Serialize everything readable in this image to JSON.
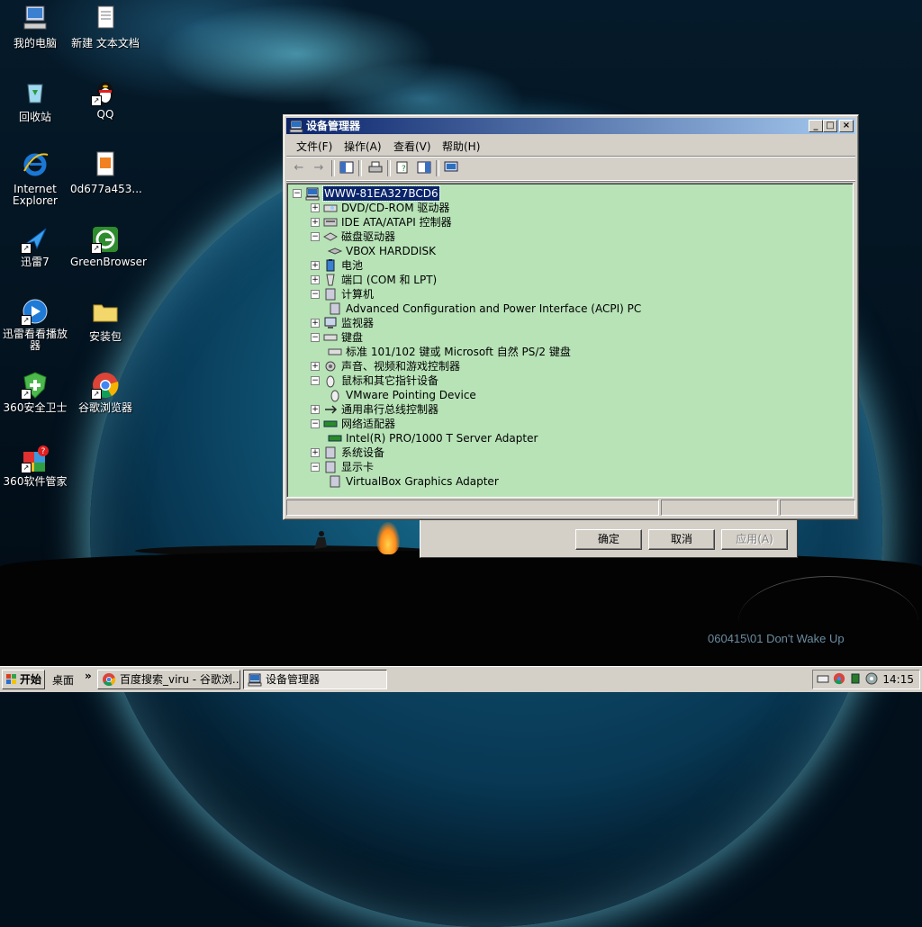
{
  "desktop": {
    "icons": [
      {
        "label": "我的电脑",
        "icon": "my-computer-icon"
      },
      {
        "label": "新建 文本文档",
        "icon": "text-document-icon"
      },
      {
        "label": "回收站",
        "icon": "recycle-bin-icon"
      },
      {
        "label": "QQ",
        "icon": "qq-penguin-icon"
      },
      {
        "label": "Internet Explorer",
        "icon": "internet-explorer-icon"
      },
      {
        "label": "0d677a453...",
        "icon": "image-file-icon"
      },
      {
        "label": "迅雷7",
        "icon": "thunder-icon"
      },
      {
        "label": "GreenBrowser",
        "icon": "greenbrowser-icon"
      },
      {
        "label": "迅雷看看播放器",
        "icon": "xunlei-player-icon"
      },
      {
        "label": "安装包",
        "icon": "folder-icon"
      },
      {
        "label": "360安全卫士",
        "icon": "360-shield-icon"
      },
      {
        "label": "谷歌浏览器",
        "icon": "chrome-icon"
      },
      {
        "label": "360软件管家",
        "icon": "360-software-icon"
      }
    ],
    "wallpaper_caption": "060415\\01 Don't Wake Up"
  },
  "bg_dialog": {
    "ok_label": "确定",
    "cancel_label": "取消",
    "apply_label": "应用(A)"
  },
  "window": {
    "title": "设备管理器",
    "menu": [
      "文件(F)",
      "操作(A)",
      "查看(V)",
      "帮助(H)"
    ],
    "tree": {
      "root": "WWW-81EA327BCD6",
      "items": [
        {
          "label": "DVD/CD-ROM 驱动器",
          "level": 1,
          "expander": "+",
          "icon": "cdrom-drive-icon"
        },
        {
          "label": "IDE ATA/ATAPI 控制器",
          "level": 1,
          "expander": "+",
          "icon": "ide-controller-icon"
        },
        {
          "label": "磁盘驱动器",
          "level": 1,
          "expander": "-",
          "icon": "disk-drive-icon"
        },
        {
          "label": "VBOX HARDDISK",
          "level": 2,
          "expander": "",
          "icon": "hard-disk-icon"
        },
        {
          "label": "电池",
          "level": 1,
          "expander": "+",
          "icon": "battery-icon"
        },
        {
          "label": "端口 (COM 和 LPT)",
          "level": 1,
          "expander": "+",
          "icon": "port-icon"
        },
        {
          "label": "计算机",
          "level": 1,
          "expander": "-",
          "icon": "computer-icon"
        },
        {
          "label": "Advanced Configuration and Power Interface (ACPI) PC",
          "level": 2,
          "expander": "",
          "icon": "acpi-pc-icon"
        },
        {
          "label": "监视器",
          "level": 1,
          "expander": "+",
          "icon": "monitor-icon"
        },
        {
          "label": "键盘",
          "level": 1,
          "expander": "-",
          "icon": "keyboard-icon"
        },
        {
          "label": "标准 101/102 键或 Microsoft 自然 PS/2 键盘",
          "level": 2,
          "expander": "",
          "icon": "keyboard-device-icon"
        },
        {
          "label": "声音、视频和游戏控制器",
          "level": 1,
          "expander": "+",
          "icon": "sound-icon"
        },
        {
          "label": "鼠标和其它指针设备",
          "level": 1,
          "expander": "-",
          "icon": "mouse-icon"
        },
        {
          "label": "VMware Pointing Device",
          "level": 2,
          "expander": "",
          "icon": "pointing-device-icon"
        },
        {
          "label": "通用串行总线控制器",
          "level": 1,
          "expander": "+",
          "icon": "usb-icon"
        },
        {
          "label": "网络适配器",
          "level": 1,
          "expander": "-",
          "icon": "network-adapter-icon"
        },
        {
          "label": "Intel(R) PRO/1000 T Server Adapter",
          "level": 2,
          "expander": "",
          "icon": "network-card-icon"
        },
        {
          "label": "系统设备",
          "level": 1,
          "expander": "+",
          "icon": "system-devices-icon"
        },
        {
          "label": "显示卡",
          "level": 1,
          "expander": "-",
          "icon": "display-adapter-icon"
        },
        {
          "label": "VirtualBox Graphics Adapter",
          "level": 2,
          "expander": "",
          "icon": "graphics-adapter-icon"
        }
      ]
    }
  },
  "taskbar": {
    "start_label": "开始",
    "desktop_label": "桌面",
    "chevron": "»",
    "tasks": [
      {
        "label": "百度搜索_viru - 谷歌浏...",
        "icon": "chrome-icon",
        "active": false
      },
      {
        "label": "设备管理器",
        "icon": "device-manager-icon",
        "active": true
      }
    ],
    "clock": "14:15"
  },
  "colors": {
    "title_active_start": "#0a246a",
    "title_active_end": "#a6caf0",
    "tree_background": "#b7e3b7",
    "face": "#d4d0c8"
  }
}
